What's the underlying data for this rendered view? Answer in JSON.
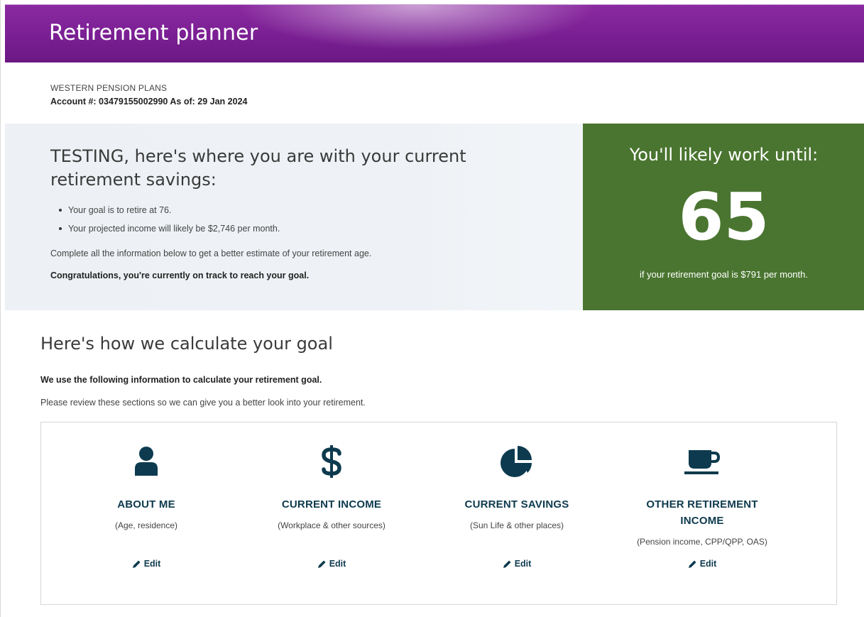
{
  "header": {
    "title": "Retirement planner"
  },
  "account": {
    "plan_name": "WESTERN PENSION PLANS",
    "account_line": "Account #: 03479155002990 As of: 29 Jan 2024"
  },
  "summary": {
    "heading": "TESTING, here's where you are with your current retirement savings:",
    "bullets": [
      "Your goal is to retire at 76.",
      "Your projected income will likely be $2,746 per month."
    ],
    "complete_text": "Complete all the information below to get a better estimate of your retirement age.",
    "congrats_text": "Congratulations, you're currently on track to reach your goal."
  },
  "work_panel": {
    "title": "You'll likely work until:",
    "age": "65",
    "subtitle": "if your retirement goal is $791 per month."
  },
  "calculation": {
    "heading": "Here's how we calculate your goal",
    "intro_bold": "We use the following information to calculate your retirement goal.",
    "review_text": "Please review these sections so we can give you a better look into your retirement.",
    "cards": [
      {
        "icon": "person-icon",
        "title": "ABOUT ME",
        "description": "(Age, residence)",
        "edit_label": "Edit"
      },
      {
        "icon": "dollar-icon",
        "title": "CURRENT INCOME",
        "description": "(Workplace & other sources)",
        "edit_label": "Edit"
      },
      {
        "icon": "pie-chart-icon",
        "title": "CURRENT SAVINGS",
        "description": "(Sun Life & other places)",
        "edit_label": "Edit"
      },
      {
        "icon": "coffee-cup-icon",
        "title": "OTHER RETIREMENT INCOME",
        "description": "(Pension income, CPP/QPP, OAS)",
        "edit_label": "Edit"
      }
    ]
  },
  "colors": {
    "banner_purple": "#7a1f93",
    "panel_green": "#4a7530",
    "summary_bg": "#eef2f6",
    "card_navy": "#0d3a4e"
  }
}
